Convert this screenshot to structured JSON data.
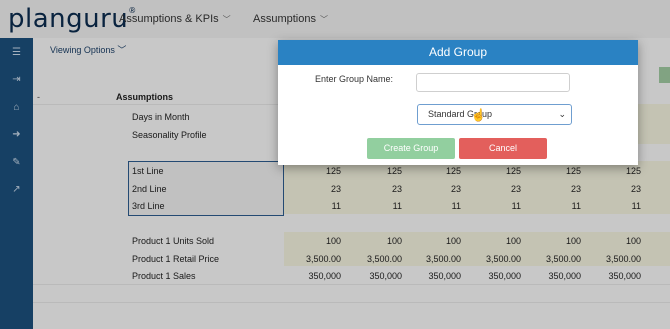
{
  "app": {
    "logo": "planguru",
    "logo_mark": "®"
  },
  "nav": {
    "assumptions_kpis": "Assumptions & KPIs",
    "assumptions": "Assumptions"
  },
  "sidebar": {
    "icons": [
      "menu-icon",
      "logout-icon",
      "home-icon",
      "arrow-right-icon",
      "wrench-icon",
      "chart-icon"
    ]
  },
  "toolbar": {
    "viewing_options": "Viewing Options"
  },
  "section": {
    "collapse": "-",
    "title": "Assumptions"
  },
  "rows": {
    "days_in_month": "Days in Month",
    "seasonality_profile": "Seasonality Profile",
    "line1": {
      "label": "1st Line",
      "values": [
        "125",
        "125",
        "125",
        "125",
        "125",
        "125"
      ]
    },
    "line2": {
      "label": "2nd Line",
      "values": [
        "23",
        "23",
        "23",
        "23",
        "23",
        "23"
      ]
    },
    "line3": {
      "label": "3rd Line",
      "values": [
        "11",
        "11",
        "11",
        "11",
        "11",
        "11"
      ]
    },
    "units": {
      "label": "Product 1 Units Sold",
      "values": [
        "100",
        "100",
        "100",
        "100",
        "100",
        "100"
      ]
    },
    "price": {
      "label": "Product 1 Retail Price",
      "values": [
        "3,500.00",
        "3,500.00",
        "3,500.00",
        "3,500.00",
        "3,500.00",
        "3,500.00"
      ]
    },
    "sales": {
      "label": "Product 1 Sales",
      "values": [
        "350,000",
        "350,000",
        "350,000",
        "350,000",
        "350,000",
        "350,000"
      ]
    }
  },
  "modal": {
    "title": "Add Group",
    "name_label": "Enter Group Name:",
    "name_value": "",
    "type_selected": "Standard Group",
    "create_label": "Create Group",
    "cancel_label": "Cancel"
  }
}
